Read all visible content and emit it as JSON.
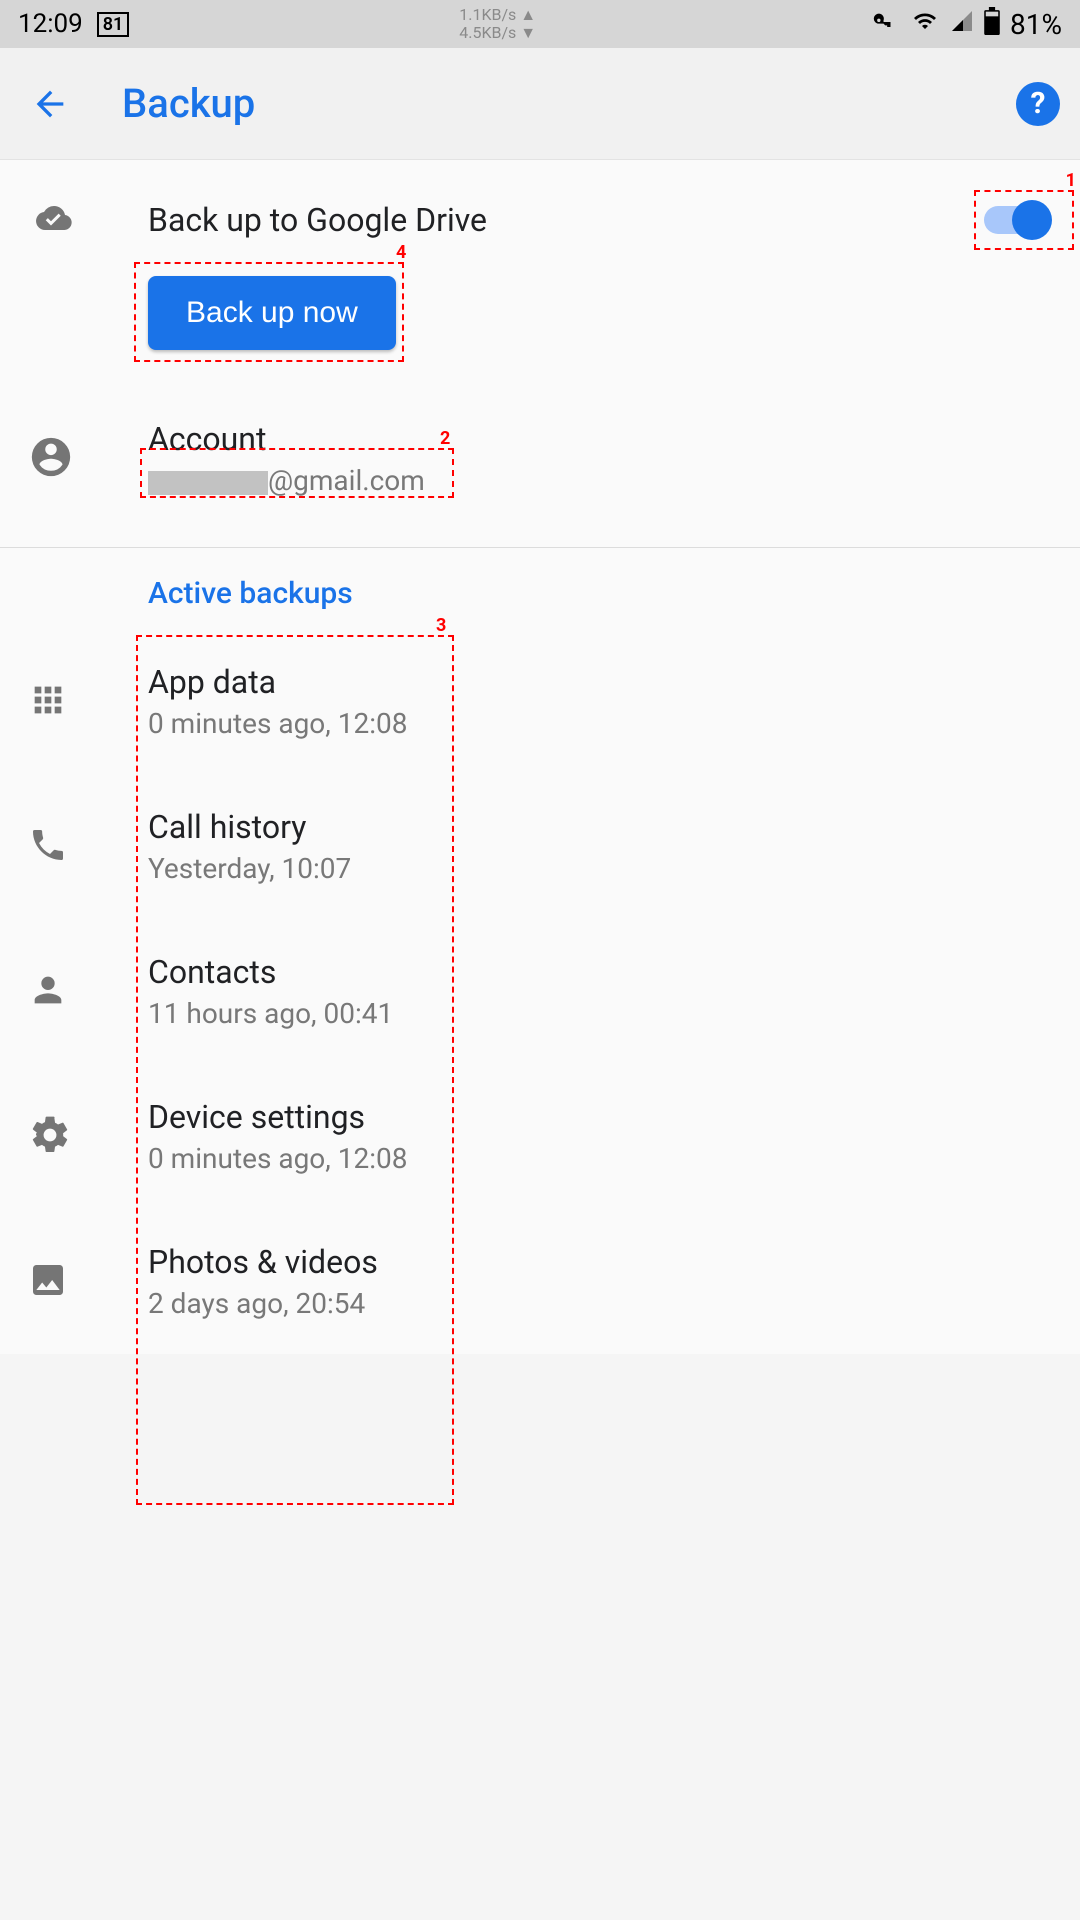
{
  "status": {
    "time": "12:09",
    "box": "81",
    "speed_up": "1.1KB/s ▲",
    "speed_down": "4.5KB/s ▼",
    "battery": "81%"
  },
  "header": {
    "title": "Backup",
    "help": "?"
  },
  "backup": {
    "toggle_label": "Back up to Google Drive",
    "button": "Back up now",
    "account_title": "Account",
    "account_email": "@gmail.com"
  },
  "active": {
    "header": "Active backups",
    "items": [
      {
        "title": "App data",
        "subtitle": "0 minutes ago, 12:08",
        "icon": "apps"
      },
      {
        "title": "Call history",
        "subtitle": "Yesterday, 10:07",
        "icon": "phone"
      },
      {
        "title": "Contacts",
        "subtitle": "11 hours ago, 00:41",
        "icon": "person"
      },
      {
        "title": "Device settings",
        "subtitle": "0 minutes ago, 12:08",
        "icon": "gear"
      },
      {
        "title": "Photos & videos",
        "subtitle": "2 days ago, 20:54",
        "icon": "image"
      }
    ]
  },
  "annotations": [
    "1",
    "2",
    "3",
    "4"
  ]
}
